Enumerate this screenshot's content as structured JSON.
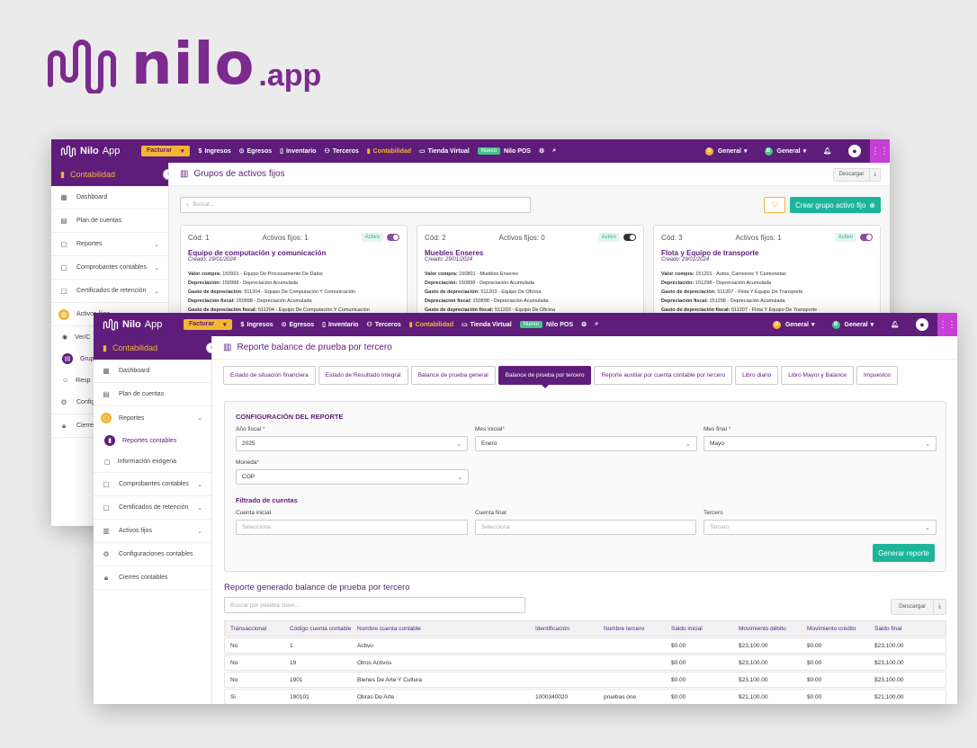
{
  "brand": {
    "name": "nilo",
    "tld": ".app"
  },
  "colors": {
    "primary": "#5e1d7a",
    "accent": "#f2b632",
    "success": "#1bb69a",
    "grid": "#c640d6"
  },
  "topbar": {
    "app_name": "Nilo",
    "app_suffix": "App",
    "facturar": "Facturar",
    "nav": [
      {
        "icon": "dollar-icon",
        "label": "Ingresos"
      },
      {
        "icon": "arrows-icon",
        "label": "Egresos"
      },
      {
        "icon": "box-icon",
        "label": "Inventario"
      },
      {
        "icon": "users-icon",
        "label": "Terceros"
      },
      {
        "icon": "book-icon",
        "label": "Contabilidad"
      },
      {
        "icon": "monitor-icon",
        "label": "Tienda Virtual"
      }
    ],
    "nuevo": "Nuevo",
    "pos": "Nilo POS",
    "company": "General",
    "branch": "General",
    "company_initial": "S",
    "branch_initial": "B",
    "notif_count": "8"
  },
  "back": {
    "sidebar": {
      "module": "Contabilidad",
      "items": [
        {
          "icon": "grid-icon",
          "label": "Dashboard"
        },
        {
          "icon": "book-open-icon",
          "label": "Plan de cuentas"
        },
        {
          "icon": "file-icon",
          "label": "Reportes"
        },
        {
          "icon": "file-icon",
          "label": "Comprobantes contables"
        },
        {
          "icon": "file-icon",
          "label": "Certificados de retención"
        },
        {
          "icon": "building-icon",
          "label": "Activos fijos"
        },
        {
          "icon": "eye-icon",
          "label": "Ver/C"
        },
        {
          "icon": "folder-icon",
          "label": "Grup"
        },
        {
          "icon": "user-icon",
          "label": "Resp"
        },
        {
          "icon": "gear-icon",
          "label": "Config"
        },
        {
          "icon": "lock-icon",
          "label": "Cierre"
        }
      ]
    },
    "page_title": "Grupos de activos fijos",
    "download": "Descargar",
    "search_placeholder": "Buscar...",
    "create": "Crear grupo activo fijo",
    "cards": [
      {
        "code": "Cód: 1",
        "assets": "Activos fijos: 1",
        "status": "Activo",
        "title": "Equipo de computación y comunicación",
        "created": "Creado: 29/01/2024",
        "lines": [
          {
            "k": "Valor compra:",
            "v": "150901 - Equipo De Procesamiento De Datos"
          },
          {
            "k": "Depreciación:",
            "v": "150998 - Depreciación Acumulada"
          },
          {
            "k": "Gasto de depreciación:",
            "v": "511204 - Equipo De Computación Y Comunicación"
          },
          {
            "k": "Depreciación fiscal:",
            "v": "150998 - Depreciación Acumulada"
          },
          {
            "k": "Gasto de depreciación fiscal:",
            "v": "511204 - Equipo De Computación Y Comunicación"
          }
        ]
      },
      {
        "code": "Cód: 2",
        "assets": "Activos fijos: 0",
        "status": "Activo",
        "title": "Muebles Enseres",
        "created": "Creado: 29/01/2024",
        "lines": [
          {
            "k": "Valor compra:",
            "v": "150801 - Muebles Enseres"
          },
          {
            "k": "Depreciación:",
            "v": "150898 - Depreciación Acumulada"
          },
          {
            "k": "Gasto de depreciación:",
            "v": "511203 - Equipo De Oficina"
          },
          {
            "k": "Depreciación fiscal:",
            "v": "150898 - Depreciación Acumulada"
          },
          {
            "k": "Gasto de depreciación fiscal:",
            "v": "511203 - Equipo De Oficina"
          }
        ]
      },
      {
        "code": "Cód: 3",
        "assets": "Activos fijos: 1",
        "status": "Activo",
        "title": "Flota y Equipo de transporte",
        "created": "Creado: 29/01/2024",
        "lines": [
          {
            "k": "Valor compra:",
            "v": "151201 - Autos, Camiones Y Camionetas"
          },
          {
            "k": "Depreciación:",
            "v": "151298 - Depreciación Acumulada"
          },
          {
            "k": "Gasto de depreciación:",
            "v": "511207 - Flota Y Equipo De Transporte"
          },
          {
            "k": "Depreciación fiscal:",
            "v": "151298 - Depreciación Acumulada"
          },
          {
            "k": "Gasto de depreciación fiscal:",
            "v": "511207 - Flota Y Equipo De Transporte"
          }
        ]
      }
    ]
  },
  "front": {
    "sidebar": {
      "module": "Contabilidad",
      "items": [
        {
          "icon": "grid-icon",
          "label": "Dashboard"
        },
        {
          "icon": "book-open-icon",
          "label": "Plan de cuentas"
        },
        {
          "icon": "file-icon",
          "label": "Reportes"
        },
        {
          "icon": "chart-icon",
          "label": "Reportes contables"
        },
        {
          "icon": "doc-icon",
          "label": "Información exógena"
        },
        {
          "icon": "file-icon",
          "label": "Comprobantes contables"
        },
        {
          "icon": "file-icon",
          "label": "Certificados de retención"
        },
        {
          "icon": "building-icon",
          "label": "Activos fijos"
        },
        {
          "icon": "gear-icon",
          "label": "Configuraciones contables"
        },
        {
          "icon": "lock-icon",
          "label": "Cierres contables"
        }
      ]
    },
    "page_title": "Reporte balance de prueba por tercero",
    "tabs": [
      "Estado de situación financiera",
      "Estado de Resultado Integral",
      "Balance de prueba general",
      "Balance de prueba por tercero",
      "Reporte auxiliar por cuenta contable por tercero",
      "Libro diario",
      "Libro Mayor y Balance",
      "Impuestos"
    ],
    "config": {
      "title": "CONFIGURACIÓN DEL REPORTE",
      "year_label": "Año fiscal",
      "year_value": "2025",
      "start_label": "Mes inicial",
      "start_value": "Enero",
      "end_label": "Mes final",
      "end_value": "Mayo",
      "currency_label": "Moneda",
      "currency_value": "COP",
      "filter_title": "Filtrado de cuentas",
      "acc_start_label": "Cuenta inicial",
      "acc_start_ph": "Selecciona",
      "acc_end_label": "Cuenta final",
      "acc_end_ph": "Selecciona",
      "third_label": "Tercero",
      "third_ph": "Tercero",
      "generate": "Generar reporte",
      "required_mark": "*"
    },
    "report": {
      "title": "Reporte generado balance de prueba por tercero",
      "search_placeholder": "Buscar por palabra clave...",
      "download": "Descargar",
      "columns": [
        "Transaccional",
        "Código cuenta contable",
        "Nombre cuenta contable",
        "Identificación",
        "Nombre tercero",
        "Saldo inicial",
        "Movimiento débito",
        "Movimiento crédito",
        "Saldo final"
      ],
      "rows": [
        [
          "No",
          "1",
          "Activo",
          "",
          "",
          "$0.00",
          "$23,100.00",
          "$0.00",
          "$23,100.00"
        ],
        [
          "No",
          "19",
          "Otros Activos",
          "",
          "",
          "$0.00",
          "$23,100.00",
          "$0.00",
          "$23,100.00"
        ],
        [
          "No",
          "1901",
          "Bienes De Arte Y Cultura",
          "",
          "",
          "$0.00",
          "$23,100.00",
          "$0.00",
          "$23,100.00"
        ],
        [
          "Si",
          "190101",
          "Obras De Arte",
          "1000340020",
          "pruebas one",
          "$0.00",
          "$21,100.00",
          "$0.00",
          "$21,100.00"
        ]
      ]
    }
  }
}
